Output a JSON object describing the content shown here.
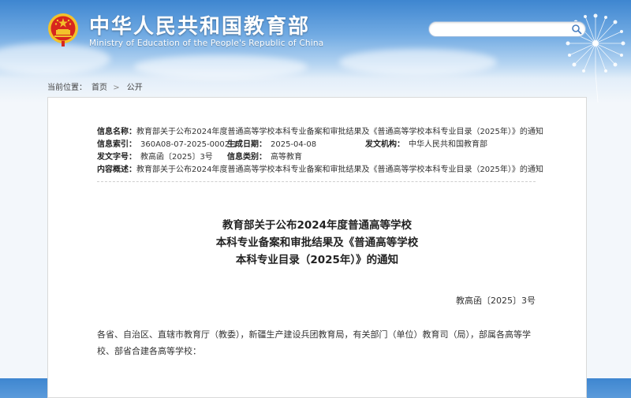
{
  "header": {
    "title": "中华人民共和国教育部",
    "subtitle": "Ministry of Education of the People's Republic of China",
    "search": {
      "placeholder": ""
    }
  },
  "breadcrumb": {
    "label": "当前位置：",
    "items": [
      "首页",
      "公开"
    ],
    "separator": ">"
  },
  "meta": {
    "name_label": "信息名称：",
    "name_value": "教育部关于公布2024年度普通高等学校本科专业备案和审批结果及《普通高等学校本科专业目录（2025年）》的通知",
    "index_label": "信息索引：",
    "index_value": "360A08-07-2025-0002-1",
    "date_label": "生成日期：",
    "date_value": "2025-04-08",
    "issuer_label": "发文机构：",
    "issuer_value": "中华人民共和国教育部",
    "docno_label": "发文字号：",
    "docno_value": "教高函〔2025〕3号",
    "category_label": "信息类别：",
    "category_value": "高等教育",
    "summary_label": "内容概述：",
    "summary_value": "教育部关于公布2024年度普通高等学校本科专业备案和审批结果及《普通高等学校本科专业目录（2025年）》的通知"
  },
  "document": {
    "title_lines": [
      "教育部关于公布2024年度普通高等学校",
      "本科专业备案和审批结果及《普通高等学校",
      "本科专业目录（2025年）》的通知"
    ],
    "number": "教高函〔2025〕3号",
    "body": "各省、自治区、直辖市教育厅（教委），新疆生产建设兵团教育局，有关部门（单位）教育司（局），部属各高等学校、部省合建各高等学校："
  },
  "colors": {
    "sky_top": "#3e86d0",
    "emblem_red": "#d7261e",
    "emblem_gold": "#f3c22b"
  }
}
